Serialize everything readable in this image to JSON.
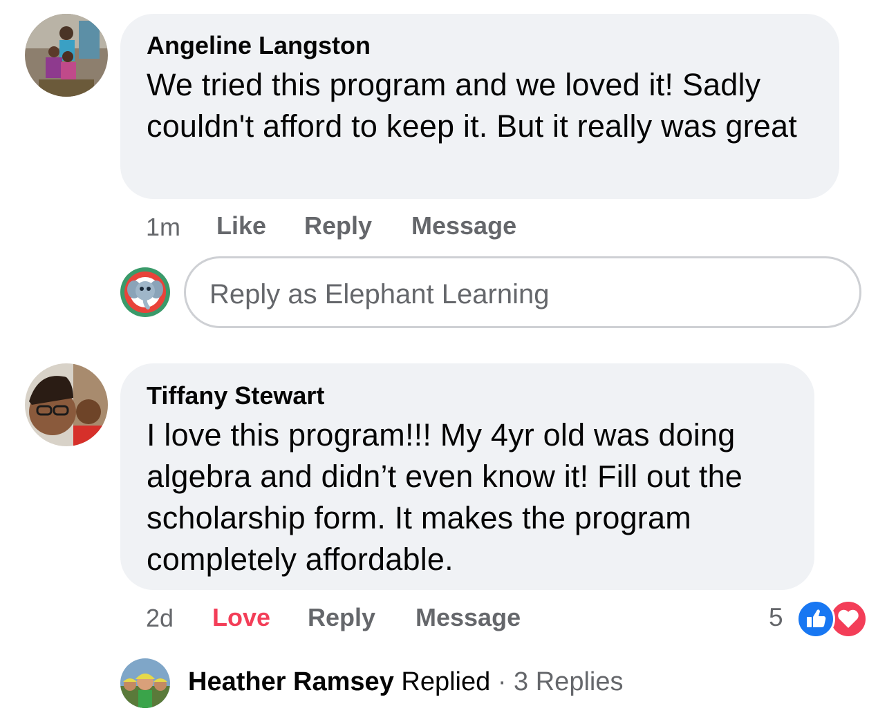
{
  "comments": [
    {
      "author": "Angeline Langston",
      "text": "We tried this program and we loved it!  Sadly couldn't afford to keep it. But it really was great",
      "time": "1m",
      "actions": {
        "like": "Like",
        "reply": "Reply",
        "message": "Message"
      }
    },
    {
      "author": "Tiffany Stewart",
      "text": "I love this program!!! My 4yr old was doing algebra and didn’t even know it! Fill out the scholarship form. It makes the program completely affordable.",
      "time": "2d",
      "actions": {
        "love": "Love",
        "reply": "Reply",
        "message": "Message"
      },
      "reactions": {
        "count": "5",
        "icons": [
          "like-reaction-icon",
          "love-reaction-icon"
        ]
      }
    }
  ],
  "reply_box": {
    "placeholder": "Reply as Elephant Learning"
  },
  "replied_summary": {
    "name": "Heather Ramsey",
    "verb": "Replied",
    "separator": "·",
    "count": "3 Replies"
  },
  "colors": {
    "bubble": "#f0f2f5",
    "meta": "#65676b",
    "love": "#f33e58",
    "like_blue": "#1877f2",
    "border": "#ced0d4"
  }
}
